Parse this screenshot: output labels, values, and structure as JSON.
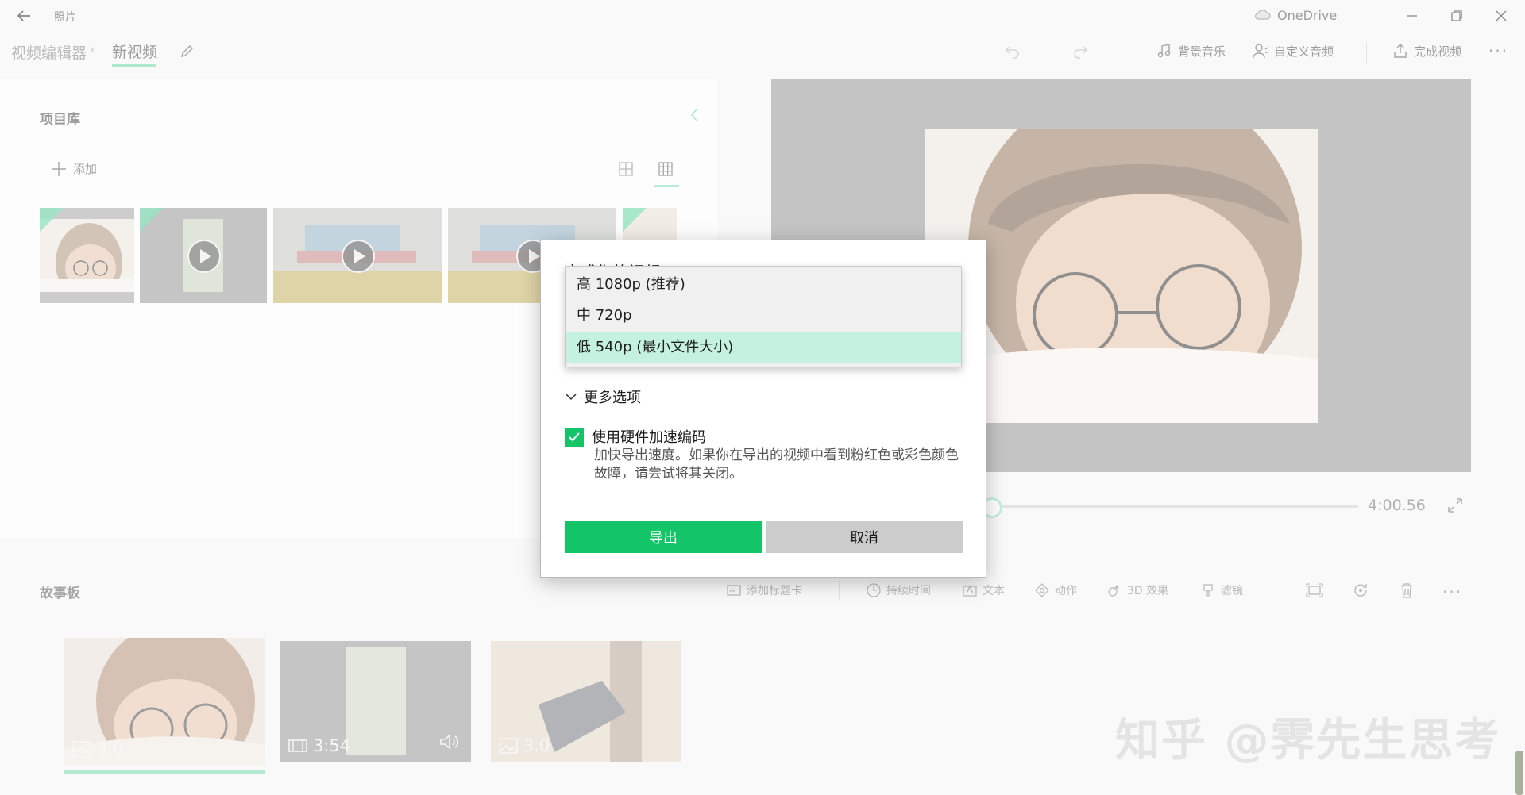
{
  "app": {
    "title": "照片",
    "onedrive": "OneDrive"
  },
  "nav": {
    "crumb_parent": "视频编辑器",
    "crumb_current": "新视频"
  },
  "toolbar": {
    "bg_music": "背景音乐",
    "custom_audio": "自定义音频",
    "finish_video": "完成视频",
    "more": "···"
  },
  "library": {
    "title": "项目库",
    "add": "添加"
  },
  "preview": {
    "total_time": "4:00.56",
    "position_fraction": 0.0
  },
  "storyboard": {
    "title": "故事板",
    "tools": {
      "add_title": "添加标题卡",
      "duration": "持续时间",
      "text": "文本",
      "motion": "动作",
      "effects3d": "3D 效果",
      "filters": "滤镜",
      "more": "···"
    },
    "clips": [
      {
        "kind": "image",
        "label": "3.0"
      },
      {
        "kind": "video",
        "label": "3:54"
      },
      {
        "kind": "image",
        "label": "3.0"
      }
    ]
  },
  "dialog": {
    "title": "完成你的视频",
    "quality_options": [
      {
        "label": "高 1080p (推荐)",
        "selected": false
      },
      {
        "label": "中 720p",
        "selected": false
      },
      {
        "label": "低 540p (最小文件大小)",
        "selected": true
      }
    ],
    "more_options": "更多选项",
    "hw_accel_label": "使用硬件加速编码",
    "hw_accel_checked": true,
    "hw_accel_desc": "加快导出速度。如果你在导出的视频中看到粉红色或彩色颜色故障，请尝试将其关闭。",
    "export_button": "导出",
    "cancel_button": "取消"
  },
  "watermark": "知乎 @霁先生思考",
  "colors": {
    "accent": "#13c468",
    "selected_option": "#c5f2de",
    "preview_bg": "#9a9a9a"
  }
}
